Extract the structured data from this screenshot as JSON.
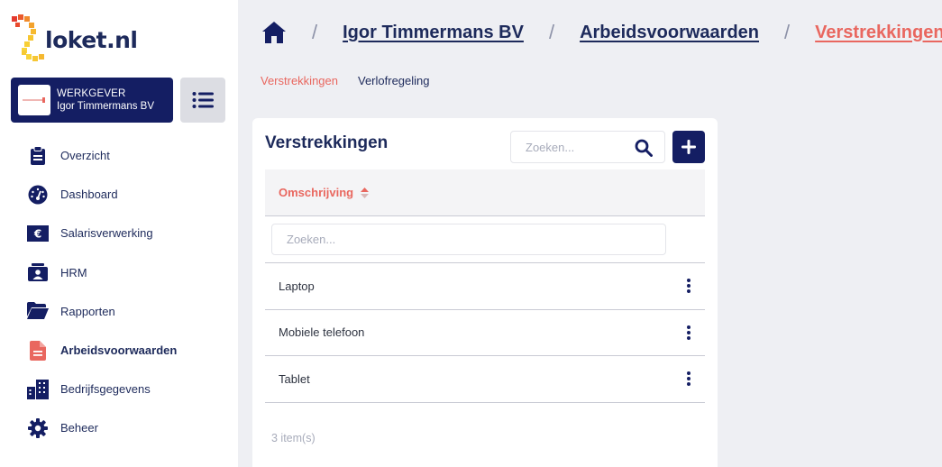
{
  "brand": {
    "logo_text": "loket.nl"
  },
  "employer": {
    "role": "WERKGEVER",
    "name": "Igor Timmermans BV"
  },
  "nav": {
    "items": [
      {
        "label": "Overzicht",
        "icon": "clipboard-icon"
      },
      {
        "label": "Dashboard",
        "icon": "gauge-icon"
      },
      {
        "label": "Salarisverwerking",
        "icon": "euro-note-icon"
      },
      {
        "label": "HRM",
        "icon": "id-card-icon"
      },
      {
        "label": "Rapporten",
        "icon": "folder-open-icon"
      },
      {
        "label": "Arbeidsvoorwaarden",
        "icon": "file-icon",
        "active": true
      },
      {
        "label": "Bedrijfsgegevens",
        "icon": "building-icon"
      },
      {
        "label": "Beheer",
        "icon": "gear-icon"
      }
    ]
  },
  "breadcrumb": {
    "separator": "/",
    "items": [
      "Igor Timmermans BV",
      "Arbeidsvoorwaarden",
      "Verstrekkingen"
    ]
  },
  "subtabs": [
    "Verstrekkingen",
    "Verlofregeling"
  ],
  "card": {
    "title": "Verstrekkingen",
    "search_placeholder": "Zoeken...",
    "table": {
      "column": "Omschrijving",
      "filter_placeholder": "Zoeken...",
      "rows": [
        "Laptop",
        "Mobiele telefoon",
        "Tablet"
      ]
    },
    "item_count": "3 item(s)"
  },
  "colors": {
    "navy": "#141e63",
    "accent": "#e9675f",
    "background": "#eeeff3"
  }
}
